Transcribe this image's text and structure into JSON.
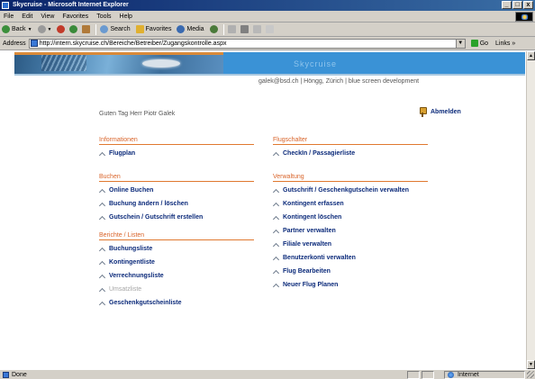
{
  "window": {
    "title": "Skycruise - Microsoft Internet Explorer",
    "controls": [
      "_",
      "□",
      "x"
    ]
  },
  "menu": [
    "File",
    "Edit",
    "View",
    "Favorites",
    "Tools",
    "Help"
  ],
  "toolbar": {
    "back": "Back",
    "search": "Search",
    "favorites": "Favorites",
    "media": "Media"
  },
  "address": {
    "label": "Address",
    "url": "http://intern.skycruise.ch/Bereiche/Betreiber/Zugangskontrolle.aspx",
    "go": "Go",
    "links": "Links"
  },
  "page": {
    "banner_title": "Skycruise",
    "contact": "galek@bsd.ch | Höngg, Zürich | blue screen development",
    "greeting": "Guten Tag Herr Piotr Galek",
    "logout": "Abmelden",
    "sections": {
      "informationen": {
        "title": "Informationen",
        "items": [
          {
            "label": "Flugplan",
            "enabled": true
          }
        ]
      },
      "buchen": {
        "title": "Buchen",
        "items": [
          {
            "label": "Online Buchen",
            "enabled": true
          },
          {
            "label": "Buchung ändern / löschen",
            "enabled": true
          },
          {
            "label": "Gutschein / Gutschrift erstellen",
            "enabled": true
          }
        ]
      },
      "berichte": {
        "title": "Berichte / Listen",
        "items": [
          {
            "label": "Buchungsliste",
            "enabled": true
          },
          {
            "label": "Kontingentliste",
            "enabled": true
          },
          {
            "label": "Verrechnungsliste",
            "enabled": true
          },
          {
            "label": "Umsatzliste",
            "enabled": false
          },
          {
            "label": "Geschenkgutscheinliste",
            "enabled": true
          }
        ]
      },
      "flugschalter": {
        "title": "Flugschalter",
        "items": [
          {
            "label": "CheckIn / Passagierliste",
            "enabled": true
          }
        ]
      },
      "verwaltung": {
        "title": "Verwaltung",
        "items": [
          {
            "label": "Gutschrift / Geschenkgutschein verwalten",
            "enabled": true
          },
          {
            "label": "Kontingent erfassen",
            "enabled": true
          },
          {
            "label": "Kontingent löschen",
            "enabled": true
          },
          {
            "label": "Partner verwalten",
            "enabled": true
          },
          {
            "label": "Filiale verwalten",
            "enabled": true
          },
          {
            "label": "Benutzerkonti verwalten",
            "enabled": true
          },
          {
            "label": "Flug Bearbeiten",
            "enabled": true
          },
          {
            "label": "Neuer Flug Planen",
            "enabled": true
          }
        ]
      }
    }
  },
  "status": {
    "text": "Done",
    "zone": "Internet"
  },
  "colors": {
    "section_title": "#d9642a",
    "link": "#0b2a7a",
    "disabled": "#a6a6a6",
    "banner": "#3a92d6"
  }
}
